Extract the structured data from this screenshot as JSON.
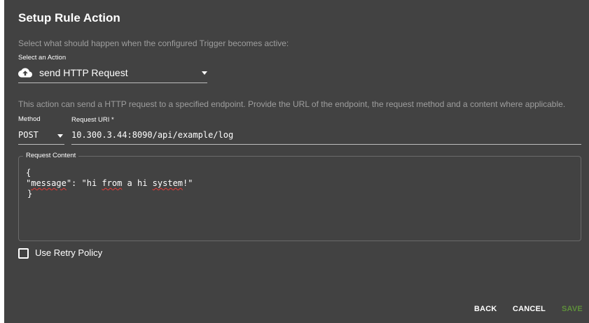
{
  "dialog": {
    "title": "Setup Rule Action",
    "description": "Select what should happen when the configured Trigger becomes active:"
  },
  "action_select": {
    "label": "Select an Action",
    "value": "send HTTP Request",
    "icon": "cloud-upload-icon"
  },
  "action_description": "This action can send a HTTP request to a specified endpoint. Provide the URL of the endpoint, the request method and a content where applicable.",
  "method": {
    "label": "Method",
    "value": "POST"
  },
  "request_uri": {
    "label": "Request URI *",
    "value": "10.300.3.44:8090/api/example/log"
  },
  "request_content": {
    "label": "Request Content",
    "line1": "{",
    "line2_key": "\"message\"",
    "line2_sep": ": ",
    "line2_q": "\"hi ",
    "line2_from": "from",
    "line2_mid": " a hi ",
    "line2_system": "system",
    "line2_end": "!\"",
    "line3": "}"
  },
  "retry": {
    "label": "Use Retry Policy",
    "checked": false
  },
  "buttons": {
    "back": "BACK",
    "cancel": "CANCEL",
    "save": "SAVE"
  },
  "colors": {
    "background": "#424242",
    "save_accent": "#5e8f3b",
    "muted_text": "#9e9e9e"
  }
}
